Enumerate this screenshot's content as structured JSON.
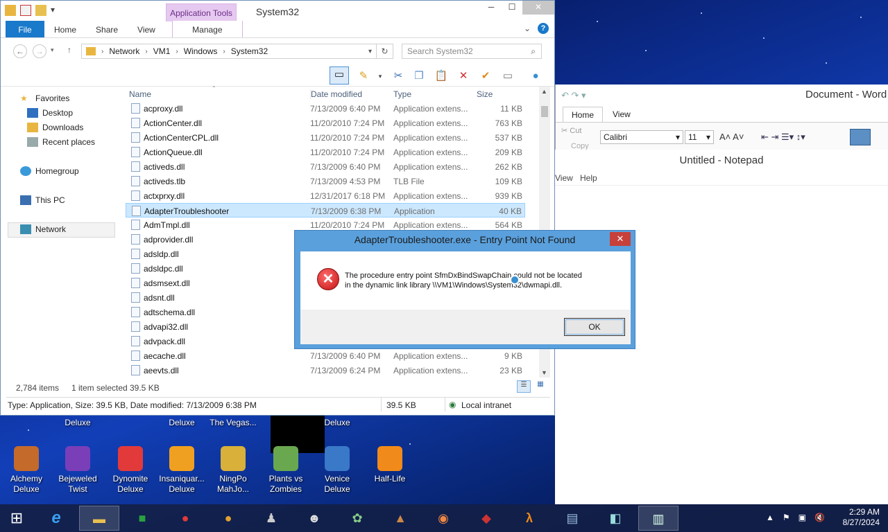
{
  "explorer": {
    "title": "System32",
    "context_tab": "Application Tools",
    "ribbon_tabs": [
      "File",
      "Home",
      "Share",
      "View",
      "Manage"
    ],
    "breadcrumb": [
      "Network",
      "VM1",
      "Windows",
      "System32"
    ],
    "search_placeholder": "Search System32",
    "nav": {
      "favorites": "Favorites",
      "desktop": "Desktop",
      "downloads": "Downloads",
      "recent": "Recent places",
      "homegroup": "Homegroup",
      "thispc": "This PC",
      "network": "Network"
    },
    "columns": [
      "Name",
      "Date modified",
      "Type",
      "Size"
    ],
    "files": [
      {
        "name": "acproxy.dll",
        "date": "7/13/2009 6:40 PM",
        "type": "Application extens...",
        "size": "11 KB"
      },
      {
        "name": "ActionCenter.dll",
        "date": "11/20/2010 7:24 PM",
        "type": "Application extens...",
        "size": "763 KB"
      },
      {
        "name": "ActionCenterCPL.dll",
        "date": "11/20/2010 7:24 PM",
        "type": "Application extens...",
        "size": "537 KB"
      },
      {
        "name": "ActionQueue.dll",
        "date": "11/20/2010 7:24 PM",
        "type": "Application extens...",
        "size": "209 KB"
      },
      {
        "name": "activeds.dll",
        "date": "7/13/2009 6:40 PM",
        "type": "Application extens...",
        "size": "262 KB"
      },
      {
        "name": "activeds.tlb",
        "date": "7/13/2009 4:53 PM",
        "type": "TLB File",
        "size": "109 KB"
      },
      {
        "name": "actxprxy.dll",
        "date": "12/31/2017 6:18 PM",
        "type": "Application extens...",
        "size": "939 KB"
      },
      {
        "name": "AdapterTroubleshooter",
        "date": "7/13/2009 6:38 PM",
        "type": "Application",
        "size": "40 KB"
      },
      {
        "name": "AdmTmpl.dll",
        "date": "11/20/2010 7:24 PM",
        "type": "Application extens...",
        "size": "564 KB"
      },
      {
        "name": "adprovider.dll",
        "date": "",
        "type": "",
        "size": ""
      },
      {
        "name": "adsldp.dll",
        "date": "",
        "type": "",
        "size": ""
      },
      {
        "name": "adsldpc.dll",
        "date": "",
        "type": "",
        "size": ""
      },
      {
        "name": "adsmsext.dll",
        "date": "",
        "type": "",
        "size": ""
      },
      {
        "name": "adsnt.dll",
        "date": "",
        "type": "",
        "size": ""
      },
      {
        "name": "adtschema.dll",
        "date": "",
        "type": "",
        "size": ""
      },
      {
        "name": "advapi32.dll",
        "date": "",
        "type": "",
        "size": ""
      },
      {
        "name": "advpack.dll",
        "date": "",
        "type": "",
        "size": ""
      },
      {
        "name": "aecache.dll",
        "date": "7/13/2009 6:40 PM",
        "type": "Application extens...",
        "size": "9 KB"
      },
      {
        "name": "aeevts.dll",
        "date": "7/13/2009 6:24 PM",
        "type": "Application extens...",
        "size": "23 KB"
      }
    ],
    "status": {
      "count": "2,784 items",
      "selected": "1 item selected",
      "size": "39.5 KB"
    },
    "info": {
      "details": "Type: Application, Size: 39.5 KB, Date modified: 7/13/2009 6:38 PM",
      "size": "39.5 KB",
      "zone": "Local intranet"
    }
  },
  "word": {
    "title": "Document - Word",
    "tabs": [
      "Home",
      "View"
    ],
    "cut": "Cut",
    "copy": "Copy",
    "font": "Calibri",
    "font_size": "11"
  },
  "notepad": {
    "title": "Untitled - Notepad",
    "menu": [
      "View",
      "Help"
    ]
  },
  "dialog": {
    "title": "AdapterTroubleshooter.exe - Entry Point Not Found",
    "message_line1": "The procedure entry point SfmDxBindSwapChain could not be located",
    "message_line2": "in the dynamic link library \\\\VM1\\Windows\\System32\\dwmapi.dll.",
    "ok": "OK"
  },
  "desktop_top_labels": [
    "Deluxe",
    "Deluxe",
    "The Vegas...",
    "Deluxe"
  ],
  "desktop_icons": [
    {
      "label1": "Alchemy",
      "label2": "Deluxe",
      "color": "#c46a2a"
    },
    {
      "label1": "Bejeweled",
      "label2": "Twist",
      "color": "#7a3fb8"
    },
    {
      "label1": "Dynomite",
      "label2": "Deluxe",
      "color": "#e23a3a"
    },
    {
      "label1": "Insaniquar...",
      "label2": "Deluxe",
      "color": "#f0a020"
    },
    {
      "label1": "NingPo",
      "label2": "MahJo...",
      "color": "#d8b03a"
    },
    {
      "label1": "Plants vs",
      "label2": "Zombies",
      "color": "#6aa84f"
    },
    {
      "label1": "Venice",
      "label2": "Deluxe",
      "color": "#3a78c8"
    },
    {
      "label1": "Half-Life",
      "label2": "",
      "color": "#f08a1a"
    }
  ],
  "taskbar": {
    "time": "2:29 AM",
    "date": "8/27/2024"
  }
}
